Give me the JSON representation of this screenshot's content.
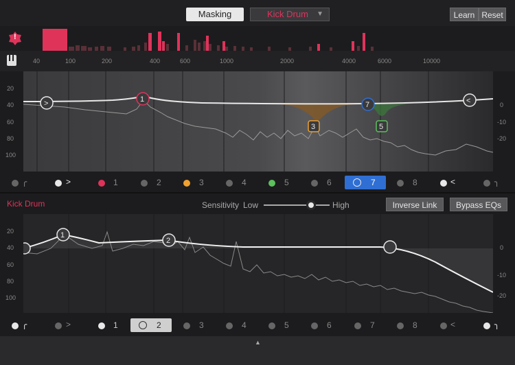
{
  "header": {
    "masking_label": "Masking",
    "track_select": "Kick Drum",
    "learn_label": "Learn",
    "reset_label": "Reset"
  },
  "warning_badge": "!",
  "freq_labels": [
    "40",
    "100",
    "200",
    "400",
    "600",
    "1000",
    "2000",
    "4000",
    "6000",
    "10000"
  ],
  "top_eq": {
    "left_axis": [
      "20",
      "40",
      "60",
      "80",
      "100"
    ],
    "right_axis": [
      "0",
      "-10",
      "-20"
    ],
    "nodes": [
      "1",
      "3",
      "5",
      "7"
    ],
    "bands": [
      "1",
      "2",
      "3",
      "4",
      "5",
      "6",
      "7",
      "8"
    ],
    "selected_band": "7"
  },
  "bottom_panel": {
    "track_label": "Kick Drum",
    "sensitivity_label": "Sensitivity",
    "low_label": "Low",
    "high_label": "High",
    "inverse_link_label": "Inverse Link",
    "bypass_label": "Bypass EQs",
    "left_axis": [
      "20",
      "40",
      "60",
      "80",
      "100"
    ],
    "right_axis": [
      "0",
      "-10",
      "-20"
    ],
    "nodes": [
      "1",
      "2"
    ],
    "bands": [
      "1",
      "2",
      "3",
      "4",
      "5",
      "6",
      "7",
      "8"
    ],
    "selected_band": "2"
  },
  "colors": {
    "accent_red": "#e0335a",
    "band_orange": "#f0a030",
    "band_green": "#5cc05c",
    "band_blue": "#2f6fd4"
  },
  "footer": {
    "collapse_icon": "▲"
  }
}
